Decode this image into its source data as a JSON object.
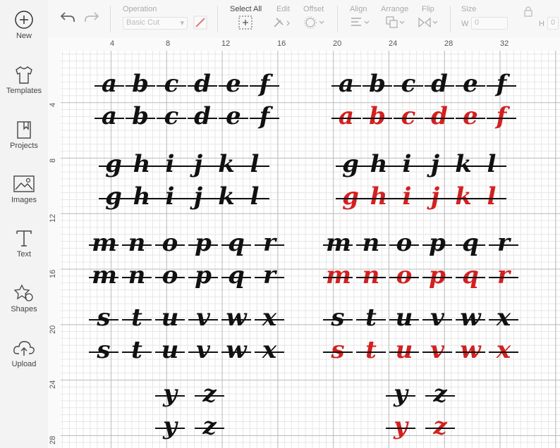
{
  "sidebar": {
    "items": [
      {
        "label": "New",
        "icon": "plus-circle-icon"
      },
      {
        "label": "Templates",
        "icon": "tshirt-icon"
      },
      {
        "label": "Projects",
        "icon": "bookmark-icon"
      },
      {
        "label": "Images",
        "icon": "image-icon"
      },
      {
        "label": "Text",
        "icon": "text-icon"
      },
      {
        "label": "Shapes",
        "icon": "shapes-icon"
      },
      {
        "label": "Upload",
        "icon": "cloud-upload-icon"
      }
    ]
  },
  "toolbar": {
    "operation_label": "Operation",
    "operation_value": "Basic Cut",
    "select_all_label": "Select All",
    "edit_label": "Edit",
    "offset_label": "Offset",
    "align_label": "Align",
    "arrange_label": "Arrange",
    "flip_label": "Flip",
    "size_label": "Size",
    "width_label": "W",
    "width_value": "0",
    "height_label": "H",
    "height_value": "0"
  },
  "ruler": {
    "top": [
      "4",
      "8",
      "12",
      "16",
      "20",
      "24",
      "28",
      "32"
    ],
    "left": [
      "4",
      "8",
      "12",
      "16",
      "20",
      "24",
      "28"
    ]
  },
  "canvas": {
    "rows": [
      [
        "a",
        "b",
        "c",
        "d",
        "e",
        "f"
      ],
      [
        "g",
        "h",
        "i",
        "j",
        "k",
        "l"
      ],
      [
        "m",
        "n",
        "o",
        "p",
        "q",
        "r"
      ],
      [
        "s",
        "t",
        "u",
        "v",
        "w",
        "x"
      ],
      [
        "y",
        "z"
      ]
    ],
    "colors": {
      "black": "#111111",
      "red": "#d42020"
    }
  }
}
